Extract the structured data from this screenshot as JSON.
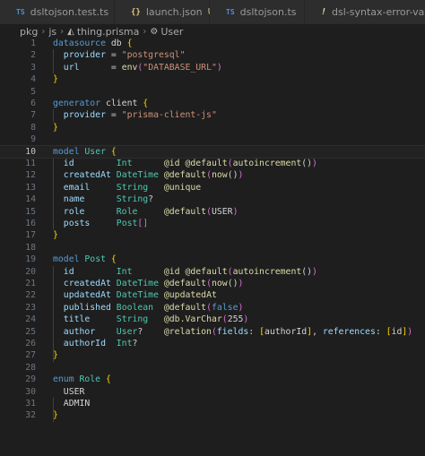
{
  "tabs": [
    {
      "icon": "TS",
      "name": "dsltojson.test.ts",
      "modified": ""
    },
    {
      "icon": "{}",
      "name": "launch.json",
      "modified": "U"
    },
    {
      "icon": "TS",
      "name": "dsltojson.ts",
      "modified": ""
    },
    {
      "icon": "!",
      "name": "dsl-syntax-error-validatio",
      "modified": ""
    }
  ],
  "breadcrumb": {
    "pkg": "pkg",
    "js": "js",
    "file": "thing.prisma",
    "symbol": "User"
  },
  "editor": {
    "current_line": 10,
    "lines": [
      [
        [
          "kw",
          "datasource"
        ],
        [
          "plain",
          " db "
        ],
        [
          "brk",
          "{"
        ]
      ],
      [
        [
          "fld",
          "  provider"
        ],
        [
          "plain",
          " = "
        ],
        [
          "str",
          "\"postgresql\""
        ]
      ],
      [
        [
          "fld",
          "  url"
        ],
        [
          "plain",
          "      = "
        ],
        [
          "fn",
          "env"
        ],
        [
          "brk2",
          "("
        ],
        [
          "str",
          "\"DATABASE_URL\""
        ],
        [
          "brk2",
          ")"
        ]
      ],
      [
        [
          "brk",
          "}"
        ]
      ],
      [],
      [
        [
          "kw",
          "generator"
        ],
        [
          "plain",
          " client "
        ],
        [
          "brk",
          "{"
        ]
      ],
      [
        [
          "fld",
          "  provider"
        ],
        [
          "plain",
          " = "
        ],
        [
          "str",
          "\"prisma-client-js\""
        ]
      ],
      [
        [
          "brk",
          "}"
        ]
      ],
      [],
      [
        [
          "kw",
          "model"
        ],
        [
          "typ",
          " User "
        ],
        [
          "brk",
          "{"
        ]
      ],
      [
        [
          "fld",
          "  id"
        ],
        [
          "plain",
          "        "
        ],
        [
          "typ",
          "Int"
        ],
        [
          "plain",
          "      "
        ],
        [
          "fn",
          "@id @default"
        ],
        [
          "brk2",
          "("
        ],
        [
          "fn",
          "autoincrement"
        ],
        [
          "plain",
          "()"
        ],
        [
          "brk2",
          ")"
        ]
      ],
      [
        [
          "fld",
          "  createdAt"
        ],
        [
          "plain",
          " "
        ],
        [
          "typ",
          "DateTime"
        ],
        [
          "plain",
          " "
        ],
        [
          "fn",
          "@default"
        ],
        [
          "brk2",
          "("
        ],
        [
          "fn",
          "now"
        ],
        [
          "plain",
          "()"
        ],
        [
          "brk2",
          ")"
        ]
      ],
      [
        [
          "fld",
          "  email"
        ],
        [
          "plain",
          "     "
        ],
        [
          "typ",
          "String"
        ],
        [
          "plain",
          "   "
        ],
        [
          "fn",
          "@unique"
        ]
      ],
      [
        [
          "fld",
          "  name"
        ],
        [
          "plain",
          "      "
        ],
        [
          "typ",
          "String"
        ],
        [
          "plain",
          "?"
        ]
      ],
      [
        [
          "fld",
          "  role"
        ],
        [
          "plain",
          "      "
        ],
        [
          "typ",
          "Role"
        ],
        [
          "plain",
          "     "
        ],
        [
          "fn",
          "@default"
        ],
        [
          "brk2",
          "("
        ],
        [
          "plain",
          "USER"
        ],
        [
          "brk2",
          ")"
        ]
      ],
      [
        [
          "fld",
          "  posts"
        ],
        [
          "plain",
          "     "
        ],
        [
          "typ",
          "Post"
        ],
        [
          "brk2",
          "[]"
        ]
      ],
      [
        [
          "brk",
          "}"
        ]
      ],
      [],
      [
        [
          "kw",
          "model"
        ],
        [
          "typ",
          " Post "
        ],
        [
          "brk",
          "{"
        ]
      ],
      [
        [
          "fld",
          "  id"
        ],
        [
          "plain",
          "        "
        ],
        [
          "typ",
          "Int"
        ],
        [
          "plain",
          "      "
        ],
        [
          "fn",
          "@id @default"
        ],
        [
          "brk2",
          "("
        ],
        [
          "fn",
          "autoincrement"
        ],
        [
          "plain",
          "()"
        ],
        [
          "brk2",
          ")"
        ]
      ],
      [
        [
          "fld",
          "  createdAt"
        ],
        [
          "plain",
          " "
        ],
        [
          "typ",
          "DateTime"
        ],
        [
          "plain",
          " "
        ],
        [
          "fn",
          "@default"
        ],
        [
          "brk2",
          "("
        ],
        [
          "fn",
          "now"
        ],
        [
          "plain",
          "()"
        ],
        [
          "brk2",
          ")"
        ]
      ],
      [
        [
          "fld",
          "  updatedAt"
        ],
        [
          "plain",
          " "
        ],
        [
          "typ",
          "DateTime"
        ],
        [
          "plain",
          " "
        ],
        [
          "fn",
          "@updatedAt"
        ]
      ],
      [
        [
          "fld",
          "  published"
        ],
        [
          "plain",
          " "
        ],
        [
          "typ",
          "Boolean"
        ],
        [
          "plain",
          "  "
        ],
        [
          "fn",
          "@default"
        ],
        [
          "brk2",
          "("
        ],
        [
          "kw",
          "false"
        ],
        [
          "brk2",
          ")"
        ]
      ],
      [
        [
          "fld",
          "  title"
        ],
        [
          "plain",
          "     "
        ],
        [
          "typ",
          "String"
        ],
        [
          "plain",
          "   "
        ],
        [
          "fn",
          "@db.VarChar"
        ],
        [
          "brk2",
          "("
        ],
        [
          "plain",
          "255"
        ],
        [
          "brk2",
          ")"
        ]
      ],
      [
        [
          "fld",
          "  author"
        ],
        [
          "plain",
          "    "
        ],
        [
          "typ",
          "User"
        ],
        [
          "plain",
          "?    "
        ],
        [
          "fn",
          "@relation"
        ],
        [
          "brk2",
          "("
        ],
        [
          "fld",
          "fields"
        ],
        [
          "plain",
          ": "
        ],
        [
          "brk",
          "["
        ],
        [
          "plain",
          "authorId"
        ],
        [
          "brk",
          "]"
        ],
        [
          "plain",
          ", "
        ],
        [
          "fld",
          "references"
        ],
        [
          "plain",
          ": "
        ],
        [
          "brk",
          "["
        ],
        [
          "plain",
          "id"
        ],
        [
          "brk",
          "]"
        ],
        [
          "brk2",
          ")"
        ]
      ],
      [
        [
          "fld",
          "  authorId"
        ],
        [
          "plain",
          "  "
        ],
        [
          "typ",
          "Int"
        ],
        [
          "plain",
          "?"
        ]
      ],
      [
        [
          "brk",
          "}"
        ]
      ],
      [],
      [
        [
          "kw",
          "enum"
        ],
        [
          "typ",
          " Role "
        ],
        [
          "brk",
          "{"
        ]
      ],
      [
        [
          "plain",
          "  USER"
        ]
      ],
      [
        [
          "plain",
          "  ADMIN"
        ]
      ],
      [
        [
          "brk",
          "}"
        ]
      ]
    ]
  }
}
